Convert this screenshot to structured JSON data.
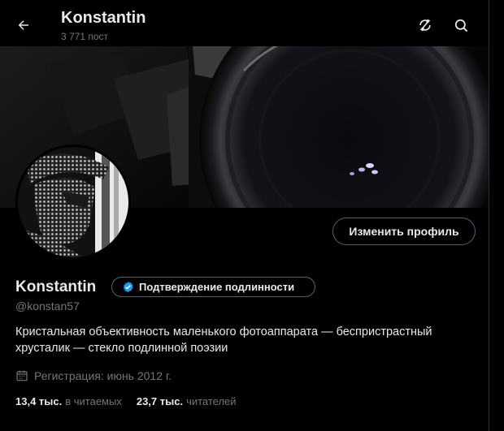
{
  "header": {
    "title": "Konstantin",
    "posts_count": "3 771 пост"
  },
  "profile": {
    "edit_button": "Изменить профиль",
    "name": "Konstantin",
    "verification_label": "Подтверждение подлинности",
    "handle": "@konstan57",
    "bio": "Кристальная объективность маленького фотоаппарата — беспристрастный хрусталик — стекло подлинной поэзии",
    "joined": "Регистрация: июнь 2012 г."
  },
  "stats": {
    "following_count": "13,4 тыс.",
    "following_label": "в читаемых",
    "followers_count": "23,7 тыс.",
    "followers_label": "читателей"
  },
  "icons": {
    "back": "arrow-left-icon",
    "sync": "circular-arrows-slashed-icon",
    "search": "search-icon",
    "verified": "verified-badge-icon",
    "calendar": "calendar-icon"
  },
  "colors": {
    "background": "#000000",
    "text": "#e7e9ea",
    "muted": "#71767b",
    "border": "#536471",
    "verified": "#1d9bf0"
  }
}
